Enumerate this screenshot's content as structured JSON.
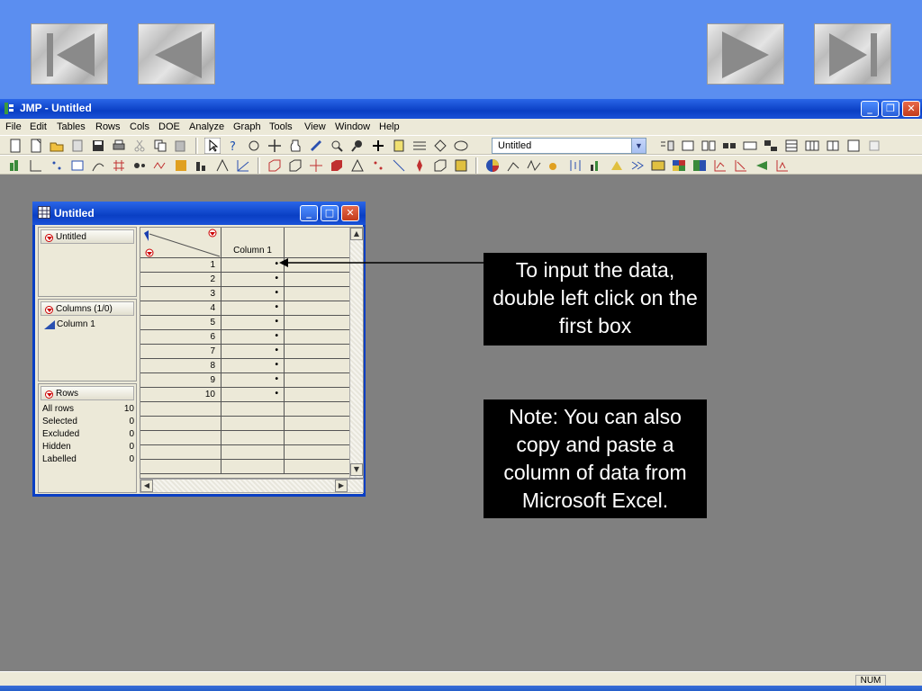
{
  "app": {
    "title": "JMP - Untitled",
    "menu": [
      "File",
      "Edit",
      "Tables",
      "Rows",
      "Cols",
      "DOE",
      "Analyze",
      "Graph",
      "Tools",
      "View",
      "Window",
      "Help"
    ],
    "table_select": "Untitled",
    "status_indicator": "NUM"
  },
  "data_window": {
    "title": "Untitled",
    "table_section": "Untitled",
    "columns_header": "Columns (1/0)",
    "column_item": "Column 1",
    "rows_header": "Rows",
    "row_stats": [
      {
        "label": "All rows",
        "value": "10"
      },
      {
        "label": "Selected",
        "value": "0"
      },
      {
        "label": "Excluded",
        "value": "0"
      },
      {
        "label": "Hidden",
        "value": "0"
      },
      {
        "label": "Labelled",
        "value": "0"
      }
    ],
    "grid": {
      "column_header": "Column 1",
      "rows": [
        {
          "n": "1",
          "v": "•"
        },
        {
          "n": "2",
          "v": "•"
        },
        {
          "n": "3",
          "v": "•"
        },
        {
          "n": "4",
          "v": "•"
        },
        {
          "n": "5",
          "v": "•"
        },
        {
          "n": "6",
          "v": "•"
        },
        {
          "n": "7",
          "v": "•"
        },
        {
          "n": "8",
          "v": "•"
        },
        {
          "n": "9",
          "v": "•"
        },
        {
          "n": "10",
          "v": "•"
        }
      ]
    }
  },
  "callouts": {
    "first": "To input the data, double left click on the first box",
    "second": "Note: You can also copy and paste a column of data from Microsoft Excel."
  },
  "colors": {
    "slide_bg": "#5b8ef0",
    "titlebar": "#0a3fc4",
    "workspace": "#808080",
    "callout_bg": "#000000"
  }
}
